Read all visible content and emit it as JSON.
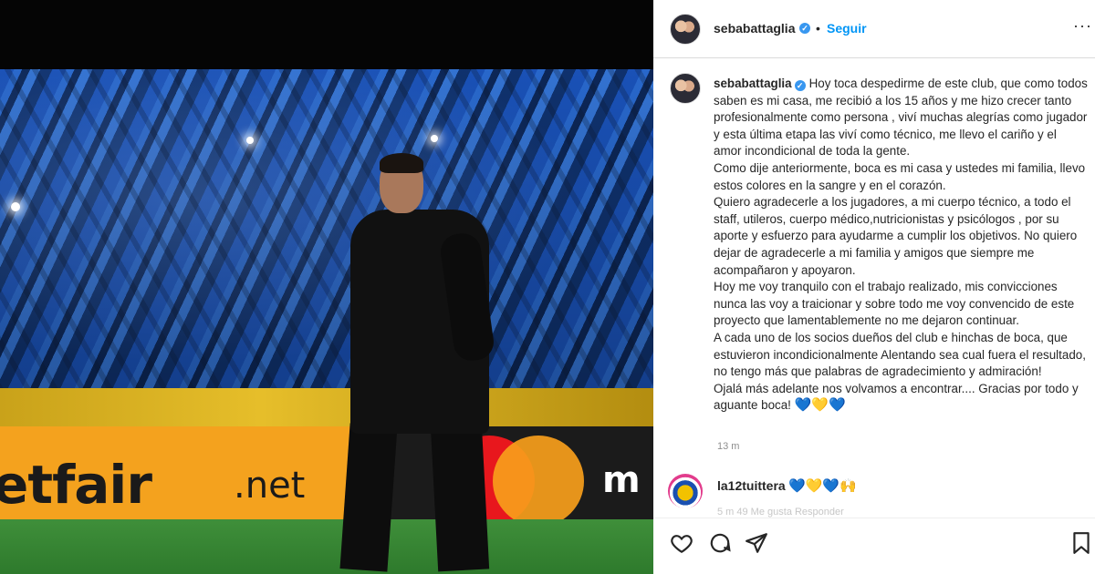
{
  "post": {
    "username": "sebabattaglia",
    "follow_label": "Seguir",
    "separator": "•",
    "caption_paragraphs": [
      "Hoy toca despedirme de este club, que como todos saben es mi casa, me recibió a los 15 años y me hizo crecer tanto profesionalmente como persona , viví muchas alegrías como jugador y esta última etapa las viví como técnico, me llevo el cariño y el amor incondicional de toda la gente.",
      "Como dije anteriormente, boca es mi casa y ustedes mi familia, llevo estos colores en la sangre y en el corazón.",
      "Quiero agradecerle a los jugadores, a mi cuerpo técnico, a todo el staff, utileros, cuerpo médico,nutricionistas y psicólogos , por su aporte y esfuerzo para ayudarme a cumplir los objetivos. No quiero dejar de agradecerle a mi familia y amigos que siempre me acompañaron y apoyaron.",
      "Hoy me voy tranquilo con el trabajo realizado, mis convicciones nunca las voy a traicionar y sobre todo me voy convencido de este proyecto que lamentablemente no me dejaron continuar.",
      "A cada uno de los socios dueños del club e hinchas de boca, que estuvieron incondicionalmente Alentando sea cual fuera el resultado, no tengo más que palabras de agradecimiento y admiración!",
      "Ojalá más adelante nos volvamos a encontrar.... Gracias por todo y aguante boca!"
    ],
    "caption_end_hearts": [
      "💙",
      "💛",
      "💙"
    ],
    "timestamp": "13 m"
  },
  "comment": {
    "username": "la12tuittera",
    "emojis": "💙💛💙🙌",
    "meta": "5 m  49 Me gusta  Responder"
  },
  "photo": {
    "ad_left_text": "etfair",
    "ad_left_suffix": ".net",
    "ad_right_text": "m"
  },
  "icons": {
    "like": "heart-outline-icon",
    "comment": "speech-bubble-icon",
    "share": "paper-plane-icon",
    "save": "bookmark-icon",
    "more": "ellipsis-icon",
    "verified": "verified-badge-icon"
  },
  "colors": {
    "follow_blue": "#0095f6",
    "verified_blue": "#3897f0",
    "text": "#262626",
    "muted": "#8e8e8e"
  }
}
